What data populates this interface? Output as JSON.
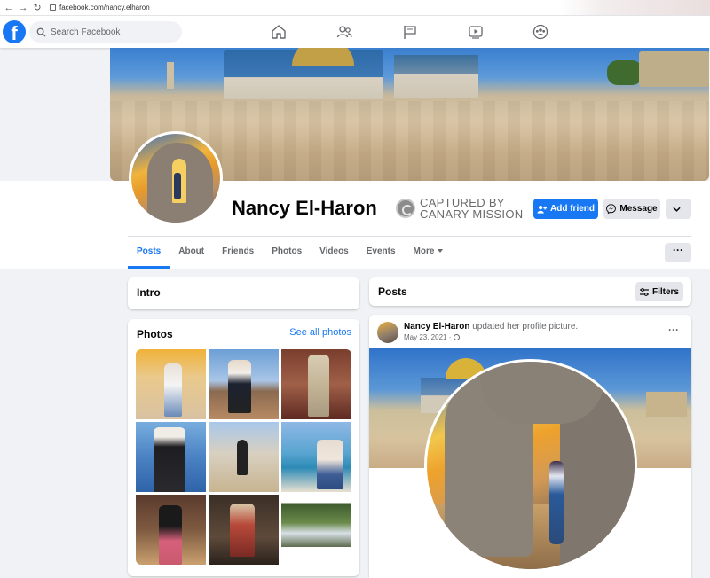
{
  "browser": {
    "url": "facebook.com/nancy.elharon",
    "back_glyph": "←",
    "forward_glyph": "→",
    "reload_glyph": "↻"
  },
  "topbar": {
    "logo": "f",
    "search_placeholder": "Search Facebook"
  },
  "profile": {
    "name": "Nancy El-Haron",
    "stamp_line1": "CAPTURED BY",
    "stamp_line2": "CANARY MISSION",
    "add_friend_label": "Add friend",
    "message_label": "Message"
  },
  "tabs": [
    "Posts",
    "About",
    "Friends",
    "Photos",
    "Videos",
    "Events",
    "More"
  ],
  "more_dots": "···",
  "intro": {
    "title": "Intro"
  },
  "photos": {
    "title": "Photos",
    "see_all": "See all photos"
  },
  "posts": {
    "title": "Posts",
    "filters_label": "Filters"
  },
  "post": {
    "author": "Nancy El-Haron",
    "action": " updated her profile picture.",
    "date": "May 23, 2021 · ",
    "dots": "···"
  },
  "colors": {
    "fb_blue": "#1877f2",
    "bg": "#f0f2f5",
    "button_grey": "#e4e6eb"
  },
  "icons": [
    "home-icon",
    "friends-icon",
    "flag-icon",
    "video-icon",
    "groups-icon",
    "search-icon",
    "add-friend-icon",
    "messenger-icon",
    "chevron-down-icon",
    "filters-icon",
    "globe-icon"
  ]
}
